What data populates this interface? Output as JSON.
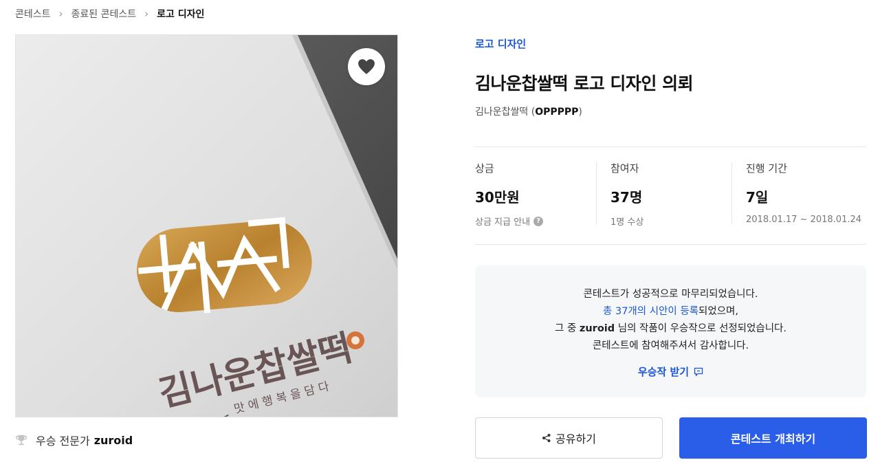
{
  "breadcrumb": {
    "items": [
      "콘테스트",
      "종료된 콘테스트",
      "로고 디자인"
    ],
    "separator": ">"
  },
  "image": {
    "logo_text": "김나운찹쌀떡",
    "logo_slogan": "맛 에 행 복 을 담 다",
    "heart_icon": "heart-icon"
  },
  "winner": {
    "icon": "trophy-icon",
    "label": "우승 전문가",
    "name": "zuroid"
  },
  "contest": {
    "category": "로고 디자인",
    "title": "김나운찹쌀떡 로고 디자인 의뢰",
    "host_name": "김나운찹쌀떡",
    "host_id": "OPPPPP"
  },
  "stats": [
    {
      "label": "상금",
      "value": "30만원",
      "sub": "상금 지급 안내"
    },
    {
      "label": "참여자",
      "value": "37명",
      "sub": "1명 수상"
    },
    {
      "label": "진행 기간",
      "value": "7일",
      "sub": "2018.01.17 ~ 2018.01.24"
    }
  ],
  "notice": {
    "line1": "콘테스트가 성공적으로 마무리되었습니다.",
    "line2_link": "총 37개의 시안이 등록",
    "line2_rest": "되었으며,",
    "line3_pre": "그 중 ",
    "line3_name": "zuroid",
    "line3_post": " 님의 작품이 우승작으로 선정되었습니다.",
    "line4": "콘테스트에 참여해주셔서 감사합니다.",
    "receive_label": "우승작 받기"
  },
  "buttons": {
    "share_label": "공유하기",
    "host_label": "콘테스트 개최하기"
  },
  "colors": {
    "accent": "#2a5de8",
    "link": "#1a56db",
    "logo_gold": "#c8923c",
    "logo_brown": "#6a5556"
  }
}
